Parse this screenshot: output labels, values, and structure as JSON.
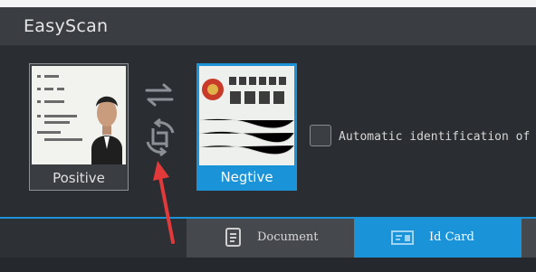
{
  "window": {
    "title": "EasyScan"
  },
  "cards": {
    "positive": {
      "label": "Positive"
    },
    "negative": {
      "label": "Negtive"
    }
  },
  "options": {
    "auto_identify_label": "Automatic identification of"
  },
  "tabs": [
    {
      "label": "Document",
      "icon": "document-icon",
      "selected": false
    },
    {
      "label": "Id Card",
      "icon": "id-card-icon",
      "selected": true
    }
  ],
  "colors": {
    "accent": "#1b93d8",
    "annotation_arrow": "#e23a3a"
  }
}
